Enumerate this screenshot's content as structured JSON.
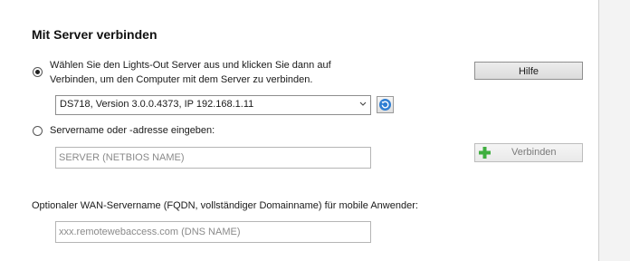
{
  "dialog": {
    "title": "Mit Server verbinden",
    "option_select": {
      "line1": "Wählen Sie den Lights-Out Server aus und klicken Sie dann auf",
      "line2": "Verbinden, um den Computer mit dem Server zu verbinden.",
      "checked": true
    },
    "server_select": {
      "value": "DS718,  Version 3.0.0.4373,  IP 192.168.1.11"
    },
    "option_manual": {
      "label": "Servername oder -adresse eingeben:",
      "checked": false
    },
    "server_input": {
      "value": "",
      "placeholder": "SERVER (NETBIOS NAME)"
    },
    "wan": {
      "label": "Optionaler WAN-Servername (FQDN, vollständiger Domainname)  für mobile Anwender:",
      "value": "",
      "placeholder": "xxx.remotewebaccess.com (DNS NAME)"
    },
    "buttons": {
      "help": "Hilfe",
      "connect": "Verbinden"
    },
    "icons": {
      "refresh": "refresh-icon",
      "add": "plus-icon",
      "dropdown": "chevron-down-icon"
    },
    "colors": {
      "plus_icon": "#3fae3f",
      "refresh_icon": "#2f7fd3"
    }
  }
}
